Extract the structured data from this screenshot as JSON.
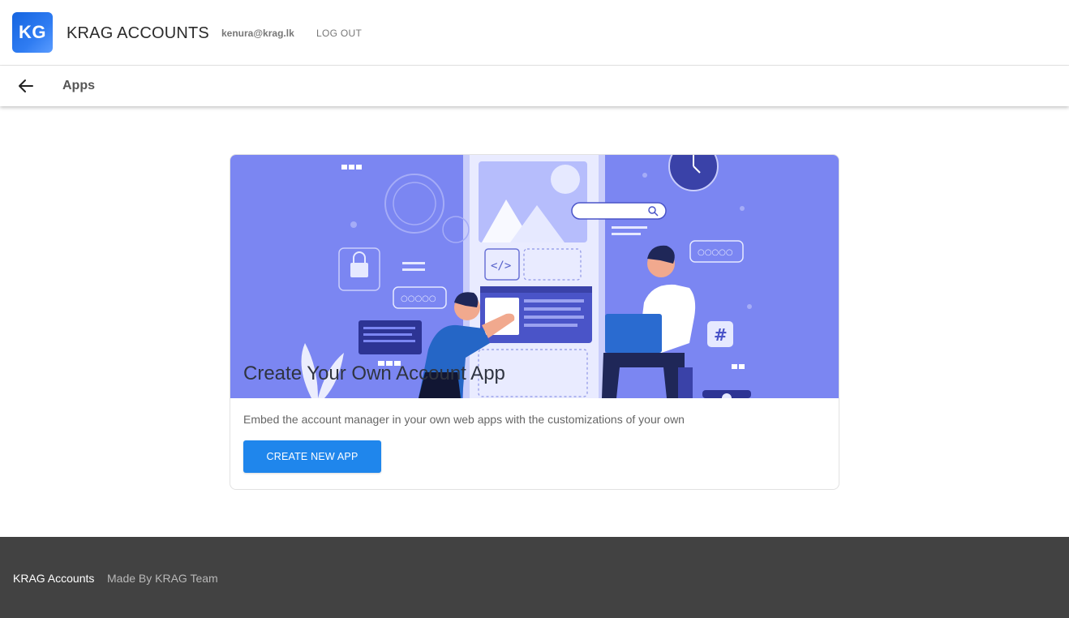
{
  "header": {
    "logo_text": "KG",
    "brand": "KRAG ACCOUNTS",
    "user_email": "kenura@krag.lk",
    "logout_label": "LOG OUT"
  },
  "subheader": {
    "back_icon": "arrow-left-icon",
    "title": "Apps"
  },
  "card": {
    "hero_title": "Create Your Own Account App",
    "description": "Embed the account manager in your own web apps with the customizations of your own",
    "button_label": "CREATE NEW APP"
  },
  "footer": {
    "brand": "KRAG Accounts",
    "credit": "Made By KRAG Team"
  },
  "colors": {
    "accent": "#1f86ec",
    "hero_bg": "#7b86f2",
    "footer_bg": "#424242"
  }
}
